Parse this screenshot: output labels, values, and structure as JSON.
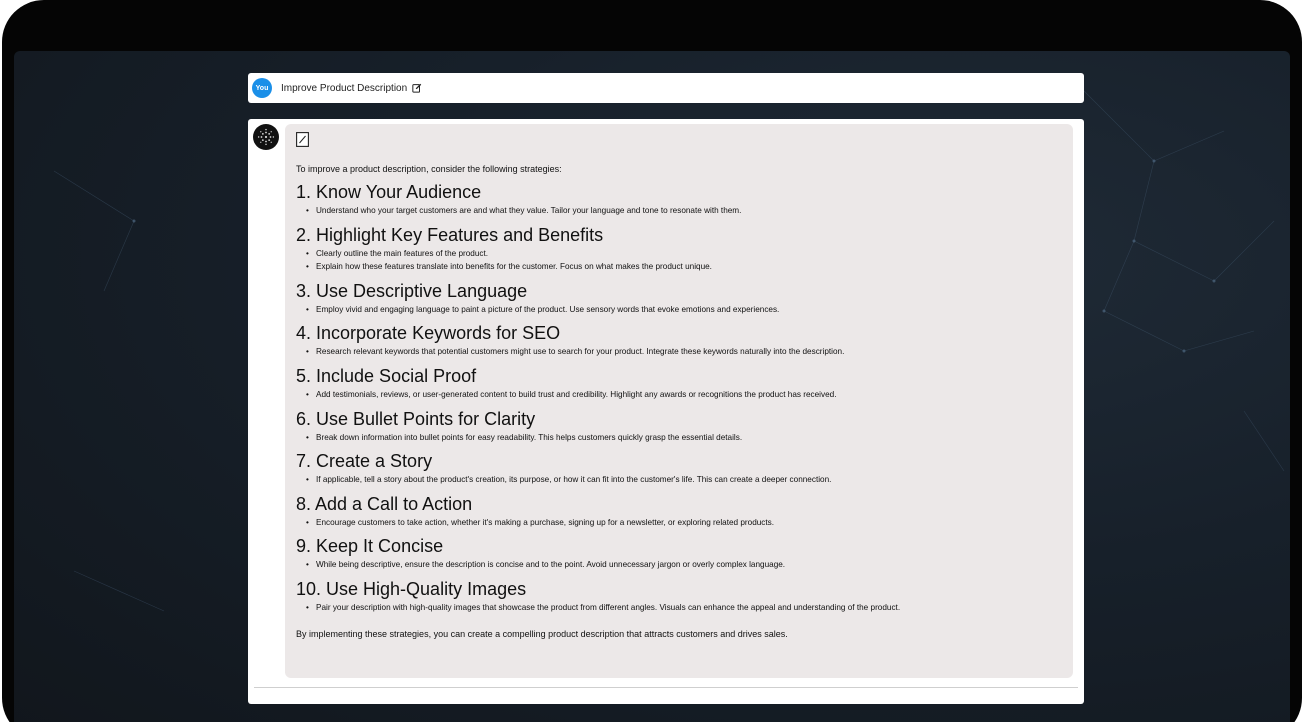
{
  "user_message": {
    "avatar_label": "You",
    "title": "Improve Product Description"
  },
  "response": {
    "intro": "To improve a product description, consider the following strategies:",
    "sections": [
      {
        "heading": "1. Know Your Audience",
        "bullets": [
          "Understand who your target customers are and what they value. Tailor your language and tone to resonate with them."
        ]
      },
      {
        "heading": "2. Highlight Key Features and Benefits",
        "bullets": [
          "Clearly outline the main features of the product.",
          "Explain how these features translate into benefits for the customer. Focus on what makes the product unique."
        ]
      },
      {
        "heading": "3. Use Descriptive Language",
        "bullets": [
          "Employ vivid and engaging language to paint a picture of the product. Use sensory words that evoke emotions and experiences."
        ]
      },
      {
        "heading": "4. Incorporate Keywords for SEO",
        "bullets": [
          "Research relevant keywords that potential customers might use to search for your product. Integrate these keywords naturally into the description."
        ]
      },
      {
        "heading": "5. Include Social Proof",
        "bullets": [
          "Add testimonials, reviews, or user-generated content to build trust and credibility. Highlight any awards or recognitions the product has received."
        ]
      },
      {
        "heading": "6. Use Bullet Points for Clarity",
        "bullets": [
          "Break down information into bullet points for easy readability. This helps customers quickly grasp the essential details."
        ]
      },
      {
        "heading": "7. Create a Story",
        "bullets": [
          "If applicable, tell a story about the product's creation, its purpose, or how it can fit into the customer's life. This can create a deeper connection."
        ]
      },
      {
        "heading": "8. Add a Call to Action",
        "bullets": [
          "Encourage customers to take action, whether it's making a purchase, signing up for a newsletter, or exploring related products."
        ]
      },
      {
        "heading": "9. Keep It Concise",
        "bullets": [
          "While being descriptive, ensure the description is concise and to the point. Avoid unnecessary jargon or overly complex language."
        ]
      },
      {
        "heading": "10. Use High-Quality Images",
        "bullets": [
          "Pair your description with high-quality images that showcase the product from different angles. Visuals can enhance the appeal and understanding of the product."
        ]
      }
    ],
    "outro": "By implementing these strategies, you can create a compelling product description that attracts customers and drives sales."
  },
  "icons": {
    "user_edit": "edit-icon",
    "bot_avatar": "bot-avatar-icon",
    "response_note": "note-icon"
  },
  "colors": {
    "avatar_blue": "#1a8fe8",
    "response_bg": "#ece8e8",
    "screen_bg": "#17202a"
  }
}
